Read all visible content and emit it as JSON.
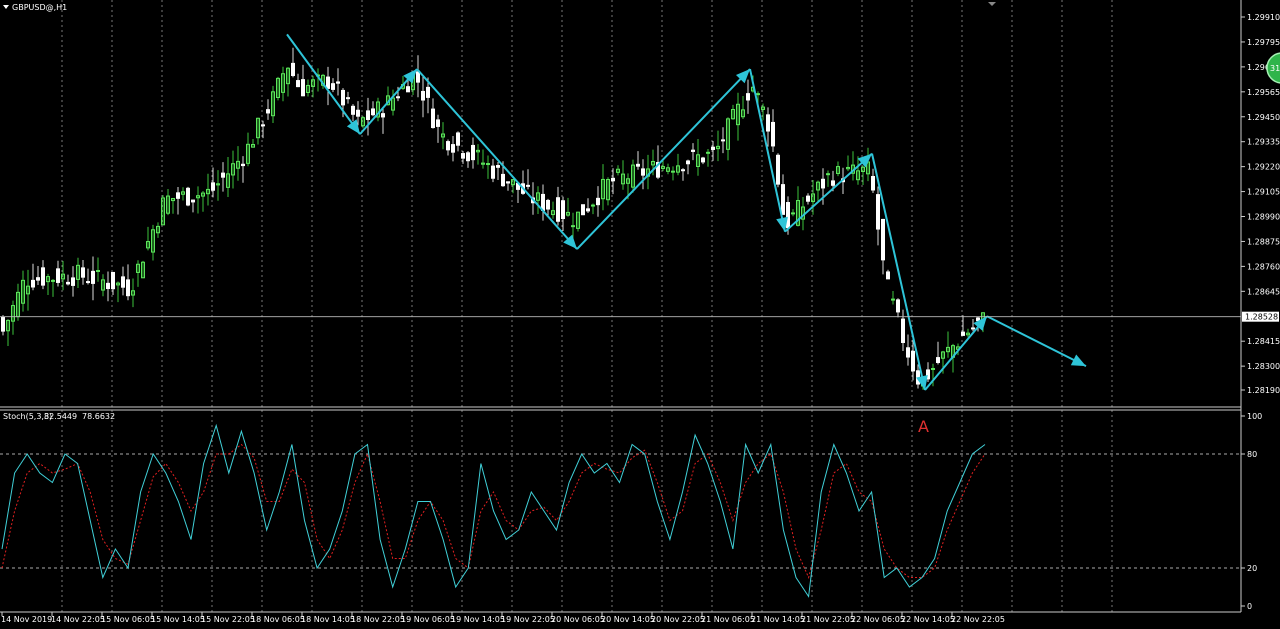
{
  "chart_data": [
    {
      "type": "candlestick",
      "symbol_label": "GBPUSD@,H1",
      "ylim": [
        1.2813,
        1.2997
      ],
      "yticks": [
        "1.29910",
        "1.29795",
        "1.29680",
        "1.29565",
        "1.29450",
        "1.29335",
        "1.29220",
        "1.29105",
        "1.28990",
        "1.28875",
        "1.28760",
        "1.28645",
        "1.28415",
        "1.28300",
        "1.28190"
      ],
      "current_price": "1.28528",
      "current_price_value": 1.28528,
      "badge_text": "31",
      "annotation": "A",
      "x_labels": [
        "14 Nov 2019",
        "14 Nov 22:05",
        "15 Nov 06:05",
        "15 Nov 14:05",
        "15 Nov 22:05",
        "18 Nov 06:05",
        "18 Nov 14:05",
        "18 Nov 22:05",
        "19 Nov 06:05",
        "19 Nov 14:05",
        "19 Nov 22:05",
        "20 Nov 06:05",
        "20 Nov 14:05",
        "20 Nov 22:05",
        "21 Nov 06:05",
        "21 Nov 14:05",
        "21 Nov 22:05",
        "22 Nov 06:05",
        "22 Nov 14:05",
        "22 Nov 22:05"
      ],
      "zigzag_prices": [
        1.2983,
        1.2937,
        1.2967,
        1.2884,
        1.2967,
        1.2892,
        1.2928,
        1.2819,
        1.2853
      ],
      "projection_price": 1.283
    },
    {
      "type": "line",
      "indicator": "Stoch(5,3,3)",
      "main_value": "82.5449",
      "signal_value": "78.6632",
      "ylim": [
        0,
        100
      ],
      "yticks": [
        "100",
        "80",
        "20",
        "0"
      ],
      "levels": [
        80,
        20
      ],
      "series": [
        {
          "name": "main",
          "values": [
            30,
            70,
            80,
            70,
            65,
            80,
            75,
            45,
            15,
            30,
            20,
            60,
            80,
            70,
            55,
            35,
            75,
            95,
            70,
            92,
            70,
            40,
            60,
            85,
            45,
            20,
            30,
            50,
            80,
            85,
            35,
            10,
            30,
            55,
            55,
            35,
            10,
            20,
            75,
            50,
            35,
            40,
            60,
            50,
            40,
            65,
            80,
            70,
            75,
            65,
            85,
            80,
            55,
            35,
            60,
            90,
            75,
            55,
            30,
            85,
            70,
            85,
            40,
            15,
            5,
            60,
            85,
            70,
            50,
            60,
            15,
            20,
            10,
            15,
            25,
            50,
            65,
            80,
            85
          ]
        },
        {
          "name": "signal",
          "values": [
            20,
            50,
            70,
            75,
            70,
            72,
            75,
            60,
            35,
            25,
            22,
            45,
            68,
            75,
            65,
            50,
            60,
            80,
            80,
            85,
            78,
            55,
            55,
            72,
            65,
            35,
            25,
            40,
            65,
            80,
            55,
            25,
            25,
            45,
            55,
            45,
            25,
            20,
            50,
            60,
            45,
            40,
            50,
            52,
            45,
            55,
            70,
            75,
            72,
            70,
            78,
            82,
            65,
            45,
            50,
            75,
            80,
            65,
            45,
            65,
            75,
            80,
            60,
            30,
            15,
            40,
            70,
            75,
            60,
            55,
            30,
            20,
            15,
            15,
            20,
            40,
            55,
            70,
            80
          ]
        }
      ]
    }
  ]
}
